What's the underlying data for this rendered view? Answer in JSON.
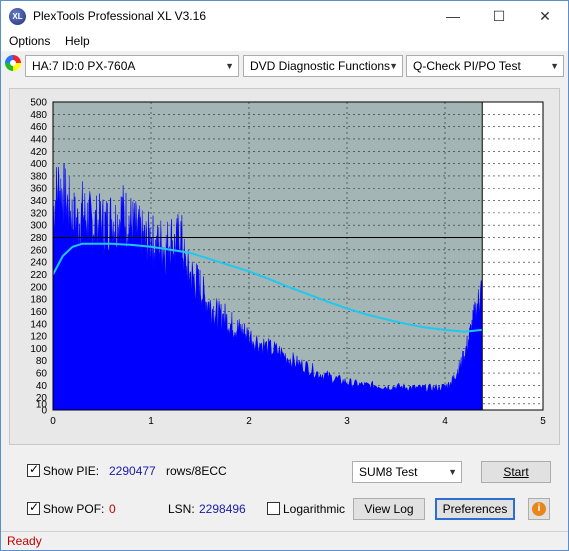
{
  "window": {
    "title": "PlexTools Professional XL V3.16",
    "icon_text": "XL",
    "minimize": "—",
    "maximize": "☐",
    "close": "✕"
  },
  "menu": {
    "items": [
      "Options",
      "Help"
    ]
  },
  "toolbar": {
    "drive": "HA:7 ID:0  PX-760A",
    "function": "DVD Diagnostic Functions",
    "test": "Q-Check PI/PO Test"
  },
  "chart_data": {
    "type": "area",
    "title": "",
    "xlabel": "",
    "ylabel": "",
    "xlim": [
      0,
      5
    ],
    "ylim": [
      0,
      500
    ],
    "x_ticks": [
      "0",
      "1",
      "2",
      "3",
      "4",
      "5"
    ],
    "y_ticks": [
      "0",
      "10",
      "20",
      "40",
      "60",
      "80",
      "100",
      "120",
      "140",
      "160",
      "180",
      "200",
      "220",
      "240",
      "260",
      "280",
      "300",
      "320",
      "340",
      "360",
      "380",
      "400",
      "420",
      "440",
      "460",
      "480",
      "500"
    ],
    "cursor": {
      "x": 4.38,
      "y": 280
    },
    "colors": {
      "pie": "#0000ff",
      "speed": "#1fc8f0",
      "plot_bg": "#a3b5b4",
      "plot_bg_empty": "#ffffff",
      "grid": "#2a2a2a"
    },
    "series": [
      {
        "values_x": [
          0.0,
          0.05,
          0.1,
          0.15,
          0.2,
          0.25,
          0.3,
          0.35,
          0.4,
          0.45,
          0.5,
          0.55,
          0.6,
          0.65,
          0.7,
          0.75,
          0.8,
          0.85,
          0.9,
          0.95,
          1.0,
          1.05,
          1.1,
          1.15,
          1.2,
          1.25,
          1.3,
          1.35,
          1.4,
          1.45,
          1.5,
          1.55,
          1.6,
          1.65,
          1.7,
          1.75,
          1.8,
          1.85,
          1.9,
          1.95,
          2.0,
          2.1,
          2.2,
          2.3,
          2.4,
          2.5,
          2.6,
          2.7,
          2.8,
          2.9,
          3.0,
          3.1,
          3.2,
          3.3,
          3.4,
          3.5,
          3.6,
          3.7,
          3.8,
          3.9,
          4.0,
          4.05,
          4.1,
          4.15,
          4.2,
          4.25,
          4.3,
          4.35,
          4.38
        ],
        "values_y": [
          320,
          360,
          350,
          330,
          310,
          300,
          320,
          310,
          300,
          300,
          300,
          300,
          310,
          300,
          320,
          310,
          300,
          290,
          280,
          270,
          280,
          260,
          270,
          260,
          280,
          260,
          290,
          230,
          220,
          210,
          200,
          180,
          170,
          160,
          150,
          150,
          140,
          135,
          130,
          125,
          120,
          110,
          100,
          95,
          85,
          75,
          70,
          60,
          55,
          50,
          45,
          42,
          40,
          40,
          38,
          38,
          37,
          36,
          36,
          36,
          38,
          42,
          55,
          70,
          90,
          120,
          150,
          180,
          200
        ]
      },
      {
        "values_x": [
          0.0,
          0.1,
          0.2,
          0.3,
          0.4,
          0.6,
          0.8,
          1.0,
          1.2,
          1.4,
          1.6,
          1.8,
          2.0,
          2.2,
          2.4,
          2.6,
          2.8,
          3.0,
          3.2,
          3.4,
          3.6,
          3.8,
          4.0,
          4.2,
          4.38
        ],
        "values_y": [
          220,
          250,
          265,
          270,
          270,
          270,
          268,
          265,
          260,
          255,
          245,
          235,
          225,
          213,
          200,
          188,
          176,
          165,
          155,
          147,
          140,
          134,
          130,
          127,
          130
        ]
      }
    ]
  },
  "controls": {
    "show_pie_label": "Show PIE:",
    "pie_value": "2290477",
    "pie_unit": "rows/8ECC",
    "show_pof_label": "Show POF:",
    "pof_value": "0",
    "lsn_label": "LSN:",
    "lsn_value": "2298496",
    "logarithmic_label": "Logarithmic",
    "sum_test": "SUM8 Test",
    "start_button": "Start",
    "view_log_button": "View Log",
    "preferences_button": "Preferences",
    "info_button": "i"
  },
  "status": {
    "text": "Ready"
  }
}
